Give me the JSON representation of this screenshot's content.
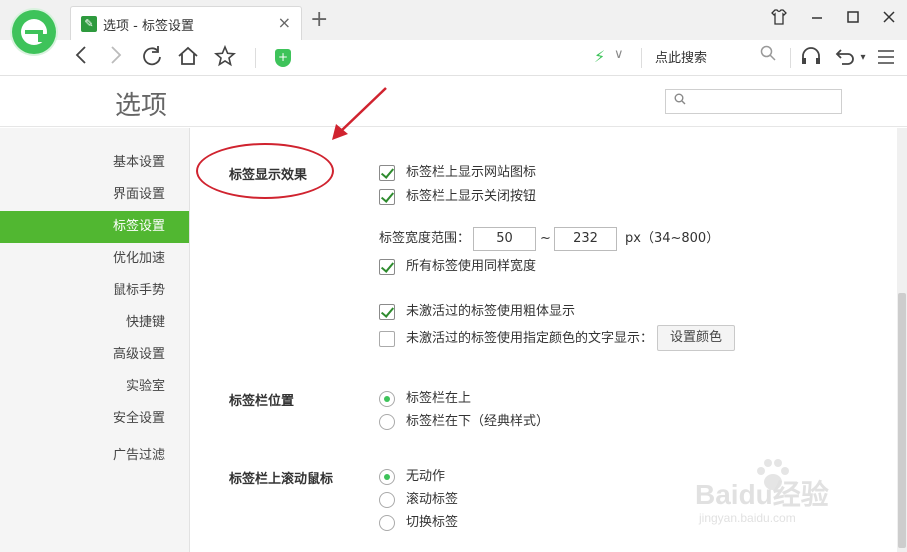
{
  "browser": {
    "tab_title": "选项 - 标签设置",
    "tab_close": "×",
    "new_tab": "+",
    "search_placeholder": "点此搜索"
  },
  "page": {
    "title": "选项"
  },
  "sidebar": {
    "items": [
      {
        "label": "基本设置",
        "active": false
      },
      {
        "label": "界面设置",
        "active": false
      },
      {
        "label": "标签设置",
        "active": true
      },
      {
        "label": "优化加速",
        "active": false
      },
      {
        "label": "鼠标手势",
        "active": false
      },
      {
        "label": "快捷键",
        "active": false
      },
      {
        "label": "高级设置",
        "active": false
      },
      {
        "label": "实验室",
        "active": false
      },
      {
        "label": "安全设置",
        "active": false
      },
      {
        "label": "广告过滤",
        "active": false
      }
    ]
  },
  "sections": {
    "display": {
      "title": "标签显示效果",
      "show_favicon": {
        "label": "标签栏上显示网站图标",
        "checked": true
      },
      "show_close": {
        "label": "标签栏上显示关闭按钮",
        "checked": true
      },
      "width_range": {
        "label": "标签宽度范围：",
        "min": "50",
        "separator": "~",
        "max": "232",
        "unit": "px（34~800）"
      },
      "same_width": {
        "label": "所有标签使用同样宽度",
        "checked": true
      },
      "inactive_bold": {
        "label": "未激活过的标签使用粗体显示",
        "checked": true
      },
      "inactive_color": {
        "label": "未激活过的标签使用指定颜色的文字显示：",
        "checked": false
      },
      "set_color_button": "设置颜色"
    },
    "position": {
      "title": "标签栏位置",
      "options": [
        {
          "label": "标签栏在上",
          "checked": true
        },
        {
          "label": "标签栏在下（经典样式）",
          "checked": false
        }
      ]
    },
    "scroll": {
      "title": "标签栏上滚动鼠标",
      "options": [
        {
          "label": "无动作",
          "checked": true
        },
        {
          "label": "滚动标签",
          "checked": false
        },
        {
          "label": "切换标签",
          "checked": false
        }
      ]
    }
  },
  "watermark": {
    "main": "Baidu经验",
    "sub": "jingyan.baidu.com"
  },
  "colors": {
    "accent_green": "#51b731",
    "annotation_red": "#d0232f"
  }
}
